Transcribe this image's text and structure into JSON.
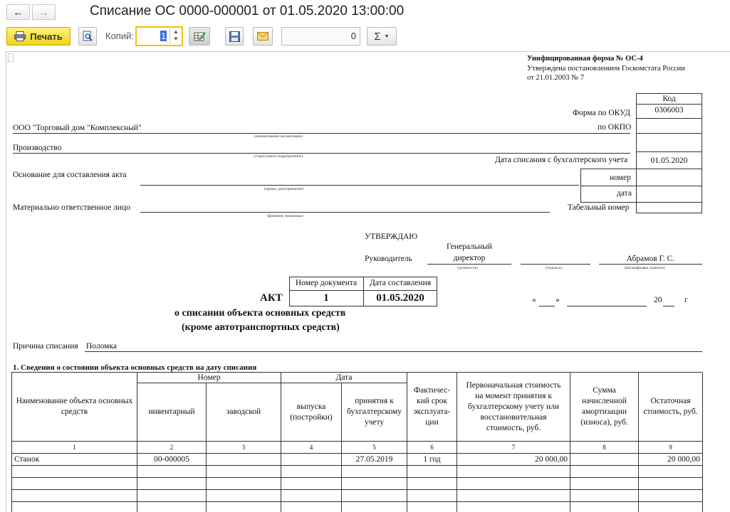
{
  "window": {
    "title": "Списание ОС 0000-000001 от 01.05.2020 13:00:00"
  },
  "toolbar": {
    "print_label": "Печать",
    "copies_label": "Копий:",
    "copies_value": "1",
    "sum_value": "0",
    "sigma": "Σ",
    "back_icon": "←",
    "forward_icon": "→"
  },
  "doc": {
    "header": {
      "form_title": "Унифицированная форма № ОС-4",
      "approved_line1": "Утверждена постановлением Госкомстата России",
      "approved_line2": "от 21.01.2003 № 7",
      "code_label": "Код",
      "okud_label": "Форма по ОКУД",
      "okud_value": "0306003",
      "okpo_label": "по ОКПО",
      "okpo_value": "",
      "writeoff_date_label": "Дата списания с бухгалтерского учета",
      "writeoff_date_value": "01.05.2020",
      "number_label": "номер",
      "date_label": "дата",
      "tab_number_label": "Табельный номер"
    },
    "org_name": "ООО \"Торговый дом \"Комплексный\"",
    "org_caption": "(наименование организации)",
    "department": "Производство",
    "department_caption": "(структурное подразделение)",
    "basis_label": "Основание для составления акта",
    "basis_caption": "(приказ, распоряжение)",
    "responsible_label": "Материально ответственное лицо",
    "responsible_caption": "(фамилия, инициалы)",
    "approve": {
      "approve_title": "УТВЕРЖДАЮ",
      "head_label": "Руководитель",
      "position_line1": "Генеральный",
      "position_line2": "директор",
      "position_caption": "(должность)",
      "signature_caption": "(подпись)",
      "name": "Абрамов Г. С.",
      "name_caption": "(расшифровка подписи)",
      "date_open_quote": "«",
      "date_close_quote": "»",
      "year_prefix": "20",
      "year_suffix": "г"
    },
    "act": {
      "doc_number_label": "Номер документа",
      "doc_date_label": "Дата составления",
      "act_label": "АКТ",
      "doc_number": "1",
      "doc_date": "01.05.2020",
      "title_line1": "о списании объекта основных средств",
      "title_line2": "(кроме автотранспортных средств)"
    },
    "reason_label": "Причина списания",
    "reason_value": "Поломка",
    "section1_title": "1. Сведения о состоянии объекта основных средств на дату списания",
    "table": {
      "h_name": "Наименование объекта основных средств",
      "h_number_group": "Номер",
      "h_date_group": "Дата",
      "h_inventory": "инвентарный",
      "h_factory": "заводской",
      "h_release": "выпуска (постройки)",
      "h_accepted": "принятия к бухгалтерскому учету",
      "h_service_life": "Фактичес-кий срок эксплуата-ции",
      "h_initial_cost": "Первоначальная стоимость на момент принятия к бухгалтерскому учету или восстановительная стоимость, руб.",
      "h_depreciation": "Сумма начисленной амортизации (износа), руб.",
      "h_residual": "Остаточная стоимость, руб.",
      "col_numbers": [
        "1",
        "2",
        "3",
        "4",
        "5",
        "6",
        "7",
        "8",
        "9"
      ],
      "rows": [
        [
          "Станок",
          "00-000005",
          "",
          "",
          "27.05.2019",
          "1 год",
          "20 000,00",
          "",
          "20 000,00"
        ]
      ]
    }
  }
}
